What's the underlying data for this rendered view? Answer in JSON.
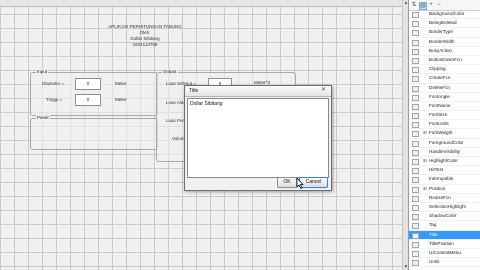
{
  "canvas": {
    "header_lines": [
      "APLIKASI PERHITUNGAN TABUNG",
      "Oleh:",
      "Dollar Sibitang",
      "1604114798"
    ]
  },
  "input_panel": {
    "title": "Input",
    "diameter_label": "Diameter =",
    "diameter_value": "0",
    "diameter_unit": "Meter",
    "tinggi_label": "Tinggi =",
    "tinggi_value": "0",
    "tinggi_unit": "Meter"
  },
  "output_panel": {
    "title": "Output",
    "luas_selimut_label": "Luas Selimut =",
    "luas_selimut_value": "0",
    "luas_selimut_unit": "Meter^2",
    "luas_alas_label": "Luas Alas",
    "luas_permukaan_label": "Luas Perm",
    "volume_label": "Volum"
  },
  "panel_box": {
    "title": "Panel"
  },
  "dialog": {
    "title": "Title",
    "text": "Dollar Sibitang",
    "ok_label": "OK",
    "cancel_label": "Cancel",
    "close_glyph": "✕"
  },
  "inspector": {
    "properties": [
      "BackgroundColor",
      "BeingDeleted",
      "BorderType",
      "BorderWidth",
      "BusyAction",
      "ButtonDownFcn",
      "Clipping",
      "CreateFcn",
      "DeleteFcn",
      "FontAngle",
      "FontName",
      "FontSize",
      "FontUnits",
      "FontWeight",
      "ForegroundColor",
      "HandleVisibility",
      "HighlightColor",
      "HitTest",
      "Interruptible",
      "Position",
      "ResizeFcn",
      "SelectionHighlight",
      "ShadowColor",
      "Tag",
      "Title",
      "TitlePosition",
      "UIContextMenu",
      "Units"
    ],
    "expandable": [
      "FontWeight",
      "HighlightColor",
      "Position"
    ],
    "selected": "Title",
    "icons": [
      "sort-alpha-icon",
      "sort-category-icon",
      "expand-icon",
      "collapse-icon"
    ]
  }
}
